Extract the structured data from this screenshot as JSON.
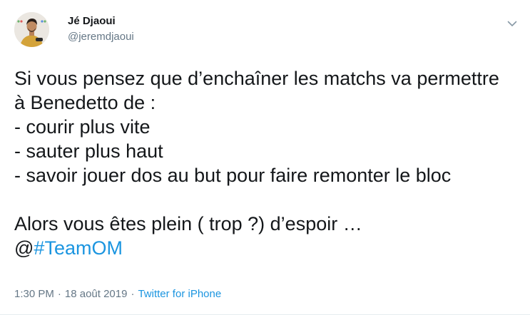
{
  "author": {
    "name": "Jé Djaoui",
    "handle": "@jeremdjaoui"
  },
  "tweet": {
    "lines": [
      "Si vous pensez que d’enchaîner les matchs va permettre",
      "à Benedetto de :",
      "- courir plus vite",
      "- sauter plus haut",
      "- savoir jouer dos au but pour faire remonter le bloc",
      "",
      "Alors vous êtes plein ( trop ?) d’espoir …"
    ],
    "mention_prefix": "@",
    "hashtag": "#TeamOM"
  },
  "meta": {
    "time": "1:30 PM",
    "separator": "·",
    "date": "18 août 2019",
    "source": "Twitter for iPhone"
  },
  "icons": {
    "menu": "chevron-down-icon",
    "avatar": "profile-photo"
  },
  "colors": {
    "link": "#1b95e0",
    "secondary_text": "#657786",
    "primary_text": "#14171a"
  }
}
